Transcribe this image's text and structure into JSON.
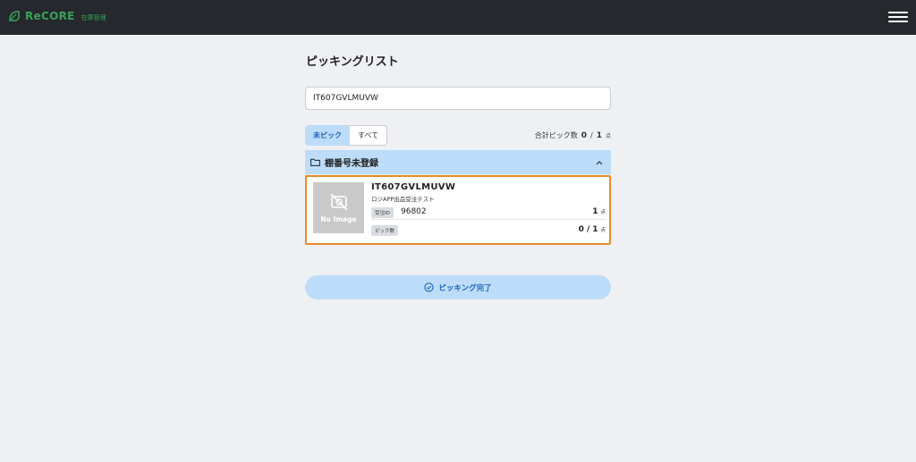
{
  "header": {
    "brand_name": "ReCORE",
    "brand_sub": "在庫管理",
    "logo_icon": "leaf-logo-icon",
    "menu_icon": "hamburger-menu-icon",
    "brand_color": "#39a05a",
    "bg_color": "#25282c"
  },
  "page": {
    "title": "ピッキングリスト"
  },
  "search": {
    "value": "IT607GVLMUVW"
  },
  "tabs": [
    {
      "label": "未ピック",
      "active": true
    },
    {
      "label": "すべて",
      "active": false
    }
  ],
  "total": {
    "label": "合計ピック数",
    "picked": "0",
    "separator": "/",
    "total": "1",
    "unit": "点"
  },
  "section": {
    "title": "棚番号未登録",
    "folder_icon": "folder-icon",
    "chevron_icon": "chevron-up-icon",
    "color": "#bcdcf9"
  },
  "item": {
    "no_image_label": "No Image",
    "code": "IT607GVLMUVW",
    "description": "ロジAPP出品受注テスト",
    "order_id_badge": "受注ID",
    "order_id": "96802",
    "order_qty": "1",
    "order_qty_unit": "点",
    "pick_badge": "ピック数",
    "pick_done": "0",
    "pick_sep": "/",
    "pick_total": "1",
    "pick_unit": "点",
    "highlight_color": "#e88a2b"
  },
  "complete_button": {
    "label": "ピッキング完了",
    "icon": "check-circle-icon"
  }
}
